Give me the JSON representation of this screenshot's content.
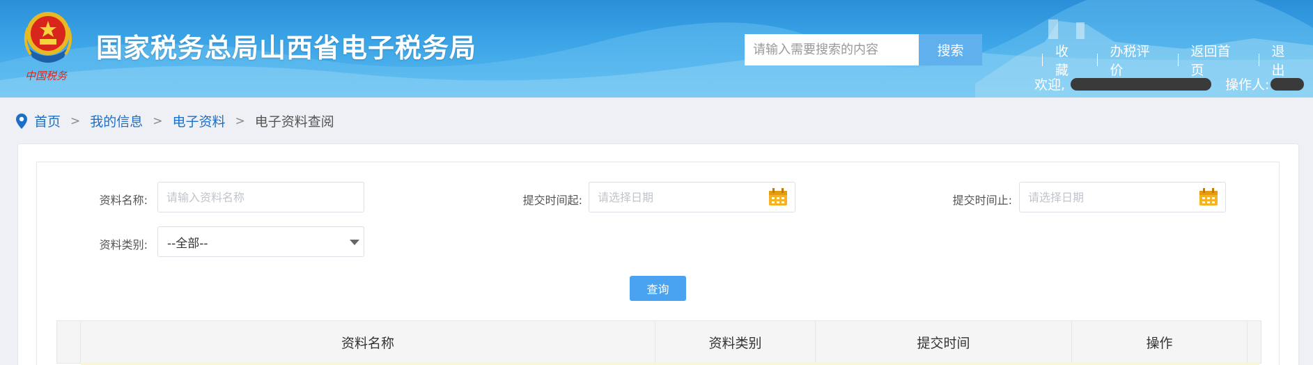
{
  "header": {
    "site_title": "国家税务总局山西省电子税务局",
    "emblem_text": "中国税务",
    "search": {
      "placeholder": "请输入需要搜索的内容",
      "button": "搜索"
    },
    "links": [
      "收藏",
      "办税评价",
      "返回首页",
      "退出"
    ],
    "welcome_label": "欢迎,",
    "operator_label": "操作人:"
  },
  "breadcrumb": {
    "items": [
      "首页",
      "我的信息",
      "电子资料"
    ],
    "separator": ">",
    "current": "电子资料查阅"
  },
  "form": {
    "name_label": "资料名称:",
    "name_placeholder": "请输入资料名称",
    "start_label": "提交时间起:",
    "start_placeholder": "请选择日期",
    "end_label": "提交时间止:",
    "end_placeholder": "请选择日期",
    "type_label": "资料类别:",
    "type_selected": "--全部--",
    "query_button": "查询"
  },
  "table": {
    "columns": [
      "资料名称",
      "资料类别",
      "提交时间",
      "操作"
    ]
  },
  "colors": {
    "header_blue": "#3aa3e6",
    "link_blue": "#1c6fc6",
    "button_blue": "#4aa3f0",
    "calendar_orange": "#f5b323"
  }
}
